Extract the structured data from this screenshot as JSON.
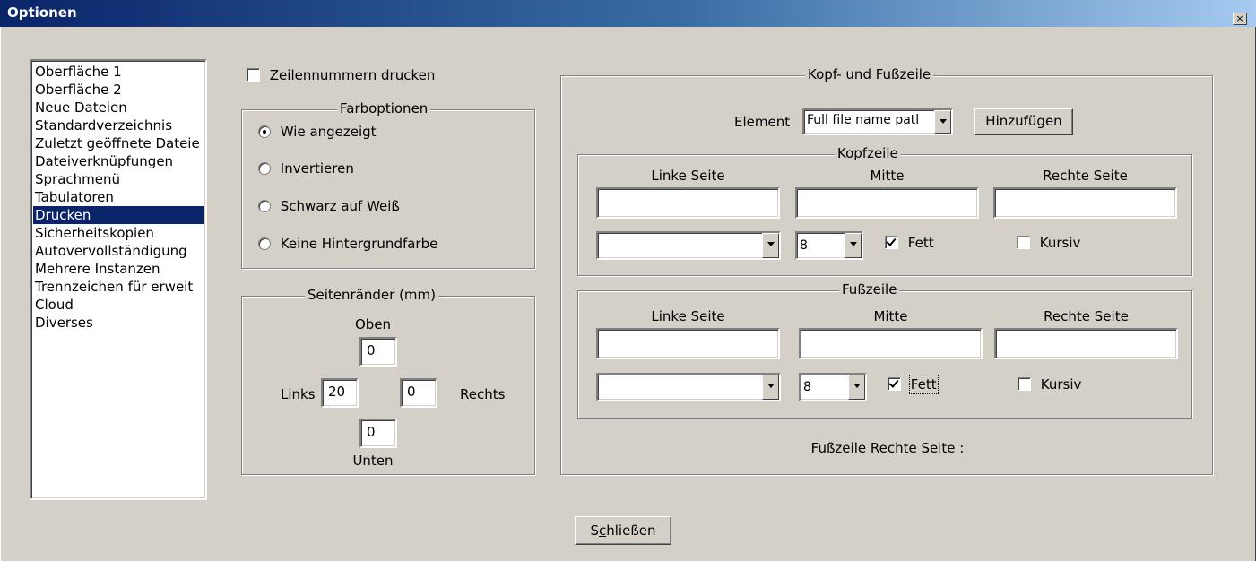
{
  "window": {
    "title": "Optionen",
    "close_glyph": "×"
  },
  "sidebar": {
    "items": [
      "Oberfläche 1",
      "Oberfläche 2",
      "Neue Dateien",
      "Standardverzeichnis",
      "Zuletzt geöffnete Dateie",
      "Dateiverknüpfungen",
      "Sprachmenü",
      "Tabulatoren",
      "Drucken",
      "Sicherheitskopien",
      "Autovervollständigung",
      "Mehrere Instanzen",
      "Trennzeichen für erweit",
      "Cloud",
      "Diverses"
    ],
    "selected_index": 8
  },
  "print": {
    "line_numbers_label": "Zeilennummern drucken",
    "line_numbers_checked": false,
    "color": {
      "title": "Farboptionen",
      "options": [
        "Wie angezeigt",
        "Invertieren",
        "Schwarz auf Weiß",
        "Keine Hintergrundfarbe"
      ],
      "selected": 0
    },
    "margins": {
      "title": "Seitenränder (mm)",
      "top_label": "Oben",
      "top": "0",
      "left_label": "Links",
      "left": "20",
      "right_label": "Rechts",
      "right": "0",
      "bottom_label": "Unten",
      "bottom": "0"
    }
  },
  "header_footer": {
    "title": "Kopf- und Fußzeile",
    "element_label": "Element",
    "element_value": "Full file name patl",
    "add_button": "Hinzufügen",
    "header": {
      "title": "Kopfzeile",
      "left_label": "Linke Seite",
      "center_label": "Mitte",
      "right_label": "Rechte Seite",
      "left_value": "",
      "center_value": "",
      "right_value": "",
      "font_value": "",
      "size_value": "8",
      "bold_label": "Fett",
      "bold_checked": true,
      "italic_label": "Kursiv",
      "italic_checked": false
    },
    "footer": {
      "title": "Fußzeile",
      "left_label": "Linke Seite",
      "center_label": "Mitte",
      "right_label": "Rechte Seite",
      "left_value": "",
      "center_value": "",
      "right_value": "",
      "font_value": "",
      "size_value": "8",
      "bold_label": "Fett",
      "bold_checked": true,
      "italic_label": "Kursiv",
      "italic_checked": false
    },
    "status": "Fußzeile Rechte Seite :"
  },
  "close_button": {
    "prefix": "S",
    "mnemonic": "c",
    "suffix": "hließen"
  }
}
